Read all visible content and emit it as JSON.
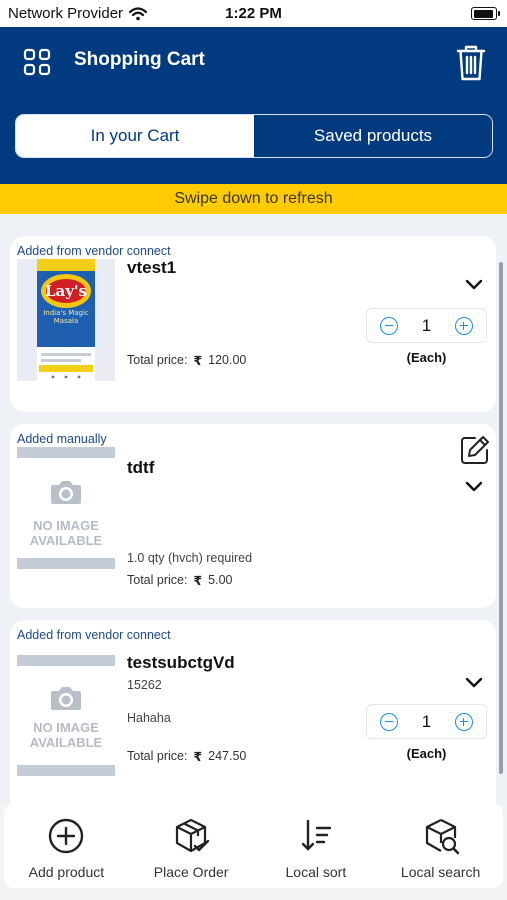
{
  "status_bar": {
    "carrier": "Network Provider",
    "time": "1:22 PM",
    "battery_level": 0.85
  },
  "header": {
    "title": "Shopping Cart"
  },
  "tabs": [
    {
      "label": "In your Cart",
      "active": true
    },
    {
      "label": "Saved products",
      "active": false
    }
  ],
  "refresh_banner": "Swipe down to refresh",
  "cart_items": [
    {
      "source": "Added from vendor connect",
      "name": "vtest1",
      "price_label": "Total price:",
      "currency": "₹",
      "price": "120.00",
      "quantity": "1",
      "unit": "(Each)",
      "image": "lays-chips-product"
    },
    {
      "source": "Added manually",
      "name": "tdtf",
      "requirement": "1.0 qty (hvch) required",
      "price_label": "Total price:",
      "currency": "₹",
      "price": "5.00",
      "no_image_text": [
        "NO IMAGE",
        "AVAILABLE"
      ]
    },
    {
      "source": "Added from vendor connect",
      "name": "testsubctgVd",
      "code": "15262",
      "description": "Hahaha",
      "price_label": "Total price:",
      "currency": "₹",
      "price": "247.50",
      "quantity": "1",
      "unit": "(Each)",
      "no_image_text": [
        "NO IMAGE",
        "AVAILABLE"
      ]
    }
  ],
  "bottom_nav": [
    {
      "label": "Add product",
      "icon": "add-circle-icon"
    },
    {
      "label": "Place Order",
      "icon": "box-check-icon"
    },
    {
      "label": "Local sort",
      "icon": "sort-icon"
    },
    {
      "label": "Local search",
      "icon": "box-search-icon"
    }
  ],
  "colors": {
    "header_bg": "#023a7f",
    "banner_bg": "#ffcb05",
    "accent_blue": "#1a8fe3",
    "content_bg": "#eef1f6"
  }
}
